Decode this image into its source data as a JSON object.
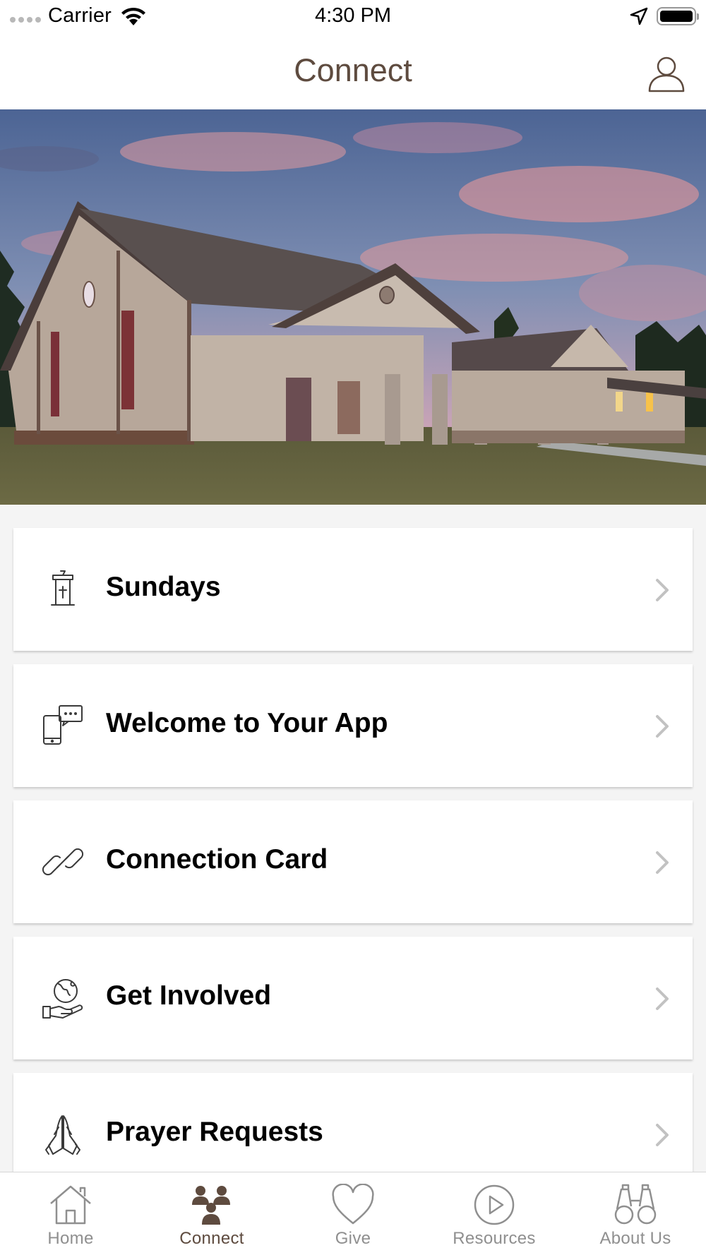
{
  "status_bar": {
    "carrier": "Carrier",
    "time": "4:30 PM"
  },
  "nav": {
    "title": "Connect",
    "profile_icon": "person-icon"
  },
  "hero": {
    "icon": "church-building-photo"
  },
  "list": {
    "items": [
      {
        "label": "Sundays",
        "icon": "pulpit-icon"
      },
      {
        "label": "Welcome to Your App",
        "icon": "phone-chat-icon"
      },
      {
        "label": "Connection Card",
        "icon": "link-icon"
      },
      {
        "label": "Get Involved",
        "icon": "globe-hand-icon"
      },
      {
        "label": "Prayer Requests",
        "icon": "praying-hands-icon"
      }
    ]
  },
  "tab_bar": {
    "tabs": [
      {
        "label": "Home",
        "icon": "home-icon",
        "active": false
      },
      {
        "label": "Connect",
        "icon": "people-icon",
        "active": true
      },
      {
        "label": "Give",
        "icon": "heart-icon",
        "active": false
      },
      {
        "label": "Resources",
        "icon": "play-circle-icon",
        "active": false
      },
      {
        "label": "About Us",
        "icon": "binoculars-icon",
        "active": false
      }
    ]
  },
  "colors": {
    "brand": "#5e4b3f",
    "inactive_tab": "#8f8f8f",
    "background": "#f4f4f4"
  }
}
